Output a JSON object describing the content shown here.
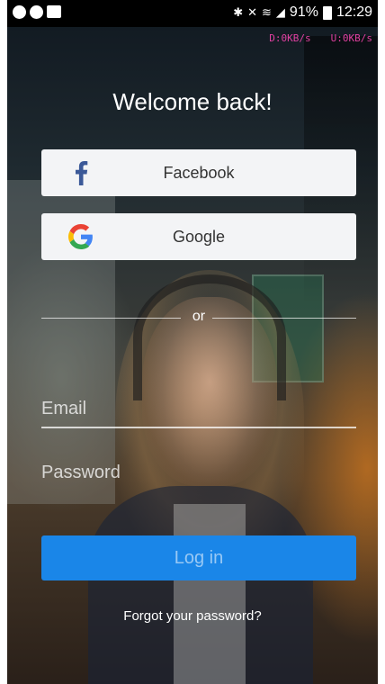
{
  "status_bar": {
    "battery_percent": "91%",
    "time": "12:29",
    "icons_left": [
      "messenger-icon",
      "messenger-icon",
      "image-icon"
    ],
    "icons_right": [
      "bluetooth-icon",
      "mute-icon",
      "wifi-icon",
      "signal-icon",
      "battery-icon"
    ]
  },
  "net_speed": {
    "download": "D:0KB/s",
    "upload": "U:0KB/s"
  },
  "login": {
    "title": "Welcome back!",
    "facebook_label": "Facebook",
    "google_label": "Google",
    "divider_text": "or",
    "email_placeholder": "Email",
    "password_placeholder": "Password",
    "login_label": "Log in",
    "forgot_label": "Forgot your password?"
  },
  "colors": {
    "facebook": "#3b5998",
    "login_button": "#1a86e8",
    "google_blue": "#4285F4",
    "google_red": "#EA4335",
    "google_yellow": "#FBBC05",
    "google_green": "#34A853"
  }
}
